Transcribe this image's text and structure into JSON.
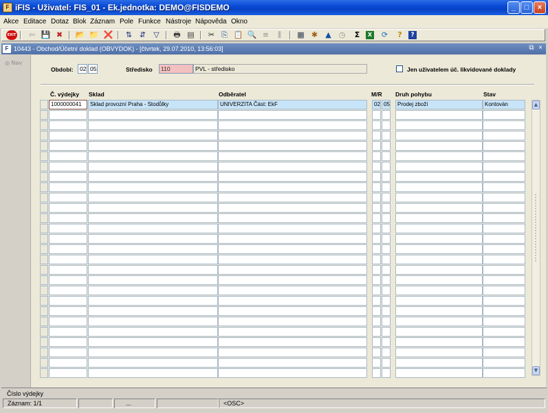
{
  "window": {
    "title": "iFIS - Uživatel: FIS_01 - Ek.jednotka: DEMO@FISDEMO",
    "icon_label": "F",
    "min_glyph": "_",
    "max_glyph": "□",
    "close_glyph": "×"
  },
  "menu": [
    {
      "label": "Akce"
    },
    {
      "label": "Editace"
    },
    {
      "label": "Dotaz"
    },
    {
      "label": "Blok"
    },
    {
      "label": "Záznam"
    },
    {
      "label": "Pole"
    },
    {
      "label": "Funkce"
    },
    {
      "label": "Nástroje"
    },
    {
      "label": "Nápověda"
    },
    {
      "label": "Okno"
    }
  ],
  "toolbar": {
    "exit_label": "EXIT",
    "icons": [
      "exit-icon",
      "back-icon",
      "save-icon",
      "delete-icon",
      "folder-open-icon",
      "folder-save-icon",
      "folder-delete-icon",
      "sort-asc-icon",
      "sort-desc-icon",
      "filter-icon",
      "print-icon",
      "print-preview-icon",
      "cut-icon",
      "copy-icon",
      "paste-icon",
      "find-icon",
      "list-icon",
      "columns-icon",
      "calculator-icon",
      "settings-icon",
      "chart-icon",
      "clock-icon",
      "sum-icon",
      "excel-icon",
      "refresh-icon",
      "help-book-icon",
      "help-icon"
    ],
    "glyphs": [
      "◉",
      "⇦",
      "💾",
      "✖",
      "📂",
      "📁",
      "❌",
      "⇅",
      "⇵",
      "▽",
      "🖶",
      "▤",
      "✂",
      "⎘",
      "📋",
      "🔍",
      "≡",
      "⫼",
      "▦",
      "✱",
      "▲",
      "◷",
      "Σ",
      "X",
      "⟳",
      "?",
      "?"
    ]
  },
  "subwindow": {
    "title": "10443 - Obchod/Účetní doklad (OBVYDOK) - [čtvrtek, 29.07.2010, 13:56:03]",
    "icon_label": "F",
    "restore_glyph": "⧉",
    "close_glyph": "×"
  },
  "nav": {
    "label": "Nav"
  },
  "filter": {
    "period_label": "Období:",
    "period_year": "02",
    "period_month": "05",
    "center_label": "Středisko",
    "center_code": "110",
    "center_name": "PVL - středisko",
    "checkbox_label": "Jen uživatelem úč. likvidované doklady"
  },
  "table": {
    "headers": {
      "doc_no": "Č. výdejky",
      "warehouse": "Sklad",
      "customer": "Odběratel",
      "mr": "M/R",
      "movement": "Druh pohybu",
      "status": "Stav"
    },
    "rows": [
      {
        "doc_no": "1000000041",
        "warehouse": "Sklad provozní Praha - Stodůlky",
        "customer": "UNIVERZITA Část: EkF",
        "m": "02",
        "r": "05",
        "movement": "Prodej zboží",
        "status": "Kontován"
      }
    ],
    "empty_rows": 26
  },
  "scrollbar": {
    "up_glyph": "▲",
    "down_glyph": "▼"
  },
  "hint": {
    "text": "Číslo výdejky"
  },
  "status": {
    "record": "Záznam: 1/1",
    "ellipsis": "...",
    "mode": "<OSC>"
  },
  "colors": {
    "title_bar": "#0a4bd6",
    "selected_row": "#c8e4f8",
    "required_field": "#f3c0c0"
  }
}
